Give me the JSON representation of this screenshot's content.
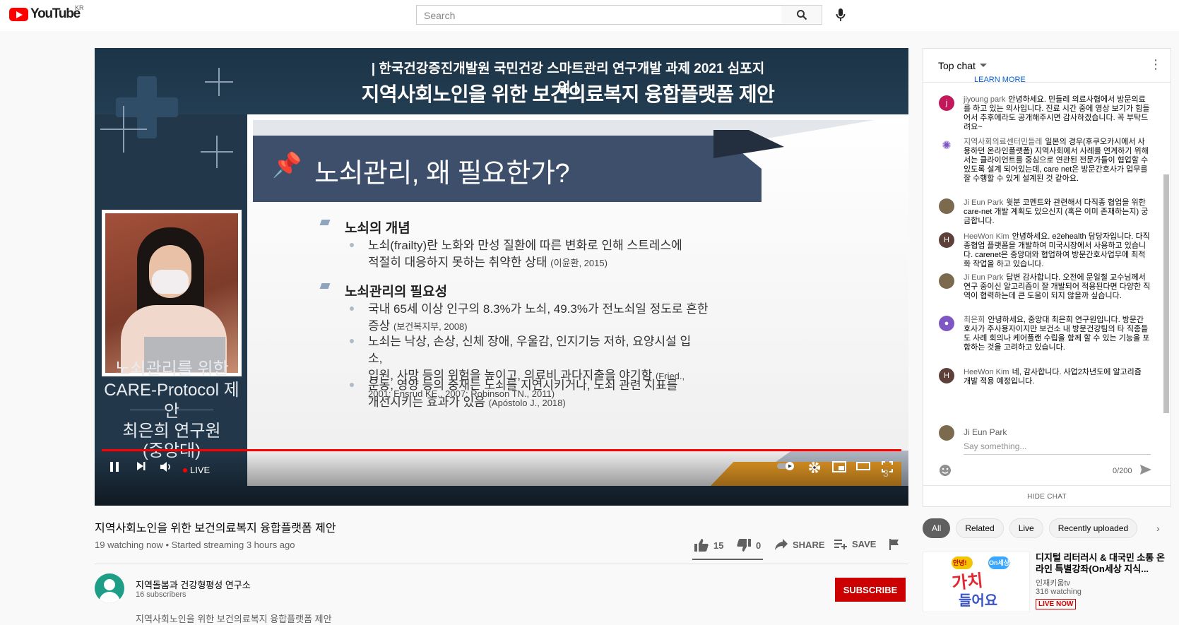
{
  "masthead": {
    "logo_text": "YouTube",
    "country": "KR",
    "search_placeholder": "Search"
  },
  "slide": {
    "header1": "| 한국건강증진개발원 국민건강 스마트관리 연구개발 과제 2021 심포지엄 |",
    "header2": "지역사회노인을 위한 보건의료복지 융합플랫폼 제안",
    "banner": "노쇠관리, 왜 필요한가?",
    "section1": "노쇠의 개념",
    "s1_b1_a": "노쇠(frailty)란 노화와 만성 질환에 따른 변화로 인해 스트레스에",
    "s1_b1_b": "적절히 대응하지 못하는 취약한 상태",
    "s1_b1_cite": "(이윤환, 2015)",
    "section2": "노쇠관리의 필요성",
    "s2_b1_a": "국내 65세 이상 인구의 8.3%가 노쇠, 49.3%가 전노쇠일 정도로 흔한",
    "s2_b1_b": "증상",
    "s2_b1_cite": "(보건복지부, 2008)",
    "s2_b2_a": "노쇠는 낙상, 손상, 신체 장애, 우울감, 인지기능 저하, 요양시설 입소,",
    "s2_b2_b": "입원, 사망 등의 위험을 높이고, 의료비 과다지출을 야기함",
    "s2_b2_cite": "(Fried., 2001; Ensrud KE., 2007; Robinson TN., 2011)",
    "s2_b3_a": "운동, 영양 등의 중재는 노쇠를 지연시키거나, 노쇠 관련 지표를",
    "s2_b3_b": "개선시키는 효과가 있음",
    "s2_b3_cite": "(Apóstolo J., 2018)",
    "page_number": "3",
    "side_caption1": "노쇠관리를 위한",
    "side_caption2": "CARE-Protocol 제안",
    "side_name": "최은희 연구원",
    "side_affil": "(중앙대)"
  },
  "player": {
    "live_label": "LIVE",
    "progress": 1.0
  },
  "video": {
    "title": "지역사회노인을 위한 보건의료복지 융합플랫폼 제안",
    "meta": "19 watching now • Started streaming 3 hours ago",
    "likes": "15",
    "dislikes": "0",
    "share": "SHARE",
    "save": "SAVE"
  },
  "channel": {
    "name": "지역돌봄과 건강형평성 연구소",
    "subscribers": "16 subscribers",
    "subscribe": "SUBSCRIBE",
    "description": "지역사회노인을 위한 보건의료복지 융합플랫폼 제안"
  },
  "chat": {
    "header": "Top chat",
    "learn_more": "LEARN MORE",
    "messages": [
      {
        "author": "jiyoung park",
        "initial": "j",
        "color": "#c2185b",
        "text": "안녕하세요. 민들레 의료사협에서 방문의료를 하고 있는 의사입니다. 진료 시간 중에 영상 보기가 힘들어서 추후에라도 공개해주시면 감사하겠습니다. 꼭 부탁드려요~"
      },
      {
        "author": "지역사회의료센터민들레",
        "initial": "✺",
        "color": "#ffffff",
        "text": "일본의 경우(후쿠오카시에서 사용하던 온라인플랫폼) 지역사회에서 사례를 연계하기 위해서는 클라이언트를 중심으로 연관된 전문가들이 협업할 수 있도록 설계 되어있는데, care net은 방문간호사가 업무를 잘 수행할 수 있게 설계된 것 같아요."
      },
      {
        "author": "Ji Eun Park",
        "initial": "",
        "color": "#7b6a4e",
        "text": "윗분 코멘트와 관련해서 다직종 협업을 위한 care-net 개발 계획도 있으신지 (혹은 이미 존재하는지) 궁금합니다."
      },
      {
        "author": "HeeWon Kim",
        "initial": "H",
        "color": "#5d4037",
        "text": "안녕하세요. e2ehealth 담당자입니다. 다직종협업 플랫폼을 개발하여 미국시장에서 사용하고 있습니다. carenet은 중앙대와 협업하여 방문간호사업무에 최적화 작업을 하고 있습니다."
      },
      {
        "author": "Ji Eun Park",
        "initial": "",
        "color": "#7b6a4e",
        "text": "답변 감사합니다. 오전에 문일철 교수님께서 연구 중이신 알고리즘이 잘 개발되어 적용된다면 다양한 직역이 협력하는데 큰 도움이 되지 않을까 싶습니다."
      },
      {
        "author": "최은희",
        "initial": "●",
        "color": "#7e57c2",
        "text": "안녕하세요, 중앙대 최은희 연구원입니다. 방문간호사가 주사용자이지만 보건소 내 방문건강팀의 타 직종들도 사례 회의나 케어플랜 수립을 함께 할 수 있는 기능을 포함하는 것을 고려하고 있습니다."
      },
      {
        "author": "HeeWon Kim",
        "initial": "H",
        "color": "#5d4037",
        "text": "네, 감사합니다. 사업2차년도에 알고리즘 개발 적용 예정입니다."
      }
    ],
    "compose_name": "Ji Eun Park",
    "compose_placeholder": "Say something...",
    "char_count": "0/200",
    "hide_chat": "HIDE CHAT"
  },
  "chips": [
    "All",
    "Related",
    "Live",
    "Recently uploaded"
  ],
  "recommended": {
    "title": "디지털 리터러시 & 대국민 소통 온라인 특별강좌(On세상 지식...",
    "channel": "인재키움tv",
    "watching": "316 watching",
    "badge": "LIVE NOW",
    "thumb_text1": "가치",
    "thumb_text2": "들어요",
    "thumb_bubble1": "안녕!",
    "thumb_bubble2": "On세상"
  }
}
